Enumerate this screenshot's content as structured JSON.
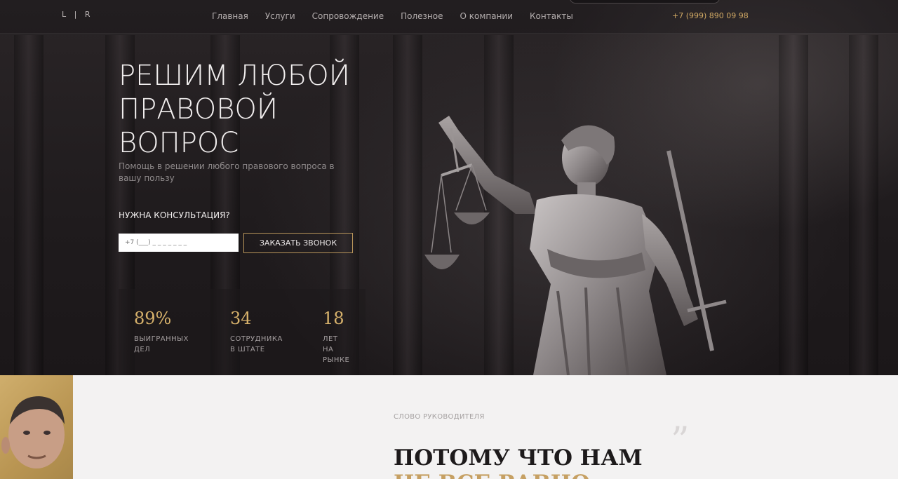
{
  "header": {
    "logo": "L | R",
    "nav": [
      "Главная",
      "Услуги",
      "Сопровождение",
      "Полезное",
      "О компании",
      "Контакты"
    ],
    "phone": "+7 (999) 890 09 98"
  },
  "hero": {
    "title_lines": [
      "РЕШИМ ЛЮБОЙ",
      "ПРАВОВОЙ",
      "ВОПРОС"
    ],
    "subtitle": "Помощь в решении любого правового вопроса в вашу пользу",
    "consult_label": "НУЖНА КОНСУЛЬТАЦИЯ?",
    "phone_placeholder": "+7 (___) _ _ _ _ _ _ _",
    "call_button": "ЗАКАЗАТЬ ЗВОНОК"
  },
  "stats": [
    {
      "value": "89%",
      "label_lines": [
        "ВЫИГРАННЫХ",
        "ДЕЛ"
      ]
    },
    {
      "value": "34",
      "label_lines": [
        "СОТРУДНИКА",
        "В ШТАТЕ"
      ]
    },
    {
      "value": "18",
      "label_lines": [
        "ЛЕТ",
        "НА",
        "РЫНКЕ"
      ]
    }
  ],
  "director": {
    "section_label": "СЛОВО РУКОВОДИТЕЛЯ",
    "quote_mark": "”",
    "title_line1": "ПОТОМУ ЧТО НАМ",
    "title_line2": "НЕ ВСЕ РАВНО"
  },
  "colors": {
    "accent": "#d1a964",
    "hero_bg": "#231f21",
    "light_bg": "#f3f2f2"
  }
}
